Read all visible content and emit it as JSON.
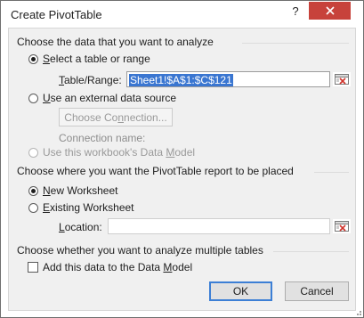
{
  "window": {
    "title": "Create PivotTable"
  },
  "title_buttons": {
    "help_label": "?",
    "close_icon": "close-icon"
  },
  "data_source": {
    "heading": "Choose the data that you want to analyze",
    "select_table": {
      "pre": "",
      "u": "S",
      "post": "elect a table or range",
      "checked": true
    },
    "table_range": {
      "u": "T",
      "post": "able/Range:",
      "value": "Sheet1!$A$1:$C$121"
    },
    "external": {
      "u": "U",
      "post": "se an external data source",
      "checked": false
    },
    "choose_connection": {
      "pre": "Choose Co",
      "u": "n",
      "post": "nection..."
    },
    "connection_name_label": "Connection name:",
    "data_model": {
      "pre": "Use this workbook's Data ",
      "u": "M",
      "post": "odel",
      "checked": false,
      "disabled": true
    }
  },
  "placement": {
    "heading": "Choose where you want the PivotTable report to be placed",
    "new_worksheet": {
      "u": "N",
      "post": "ew Worksheet",
      "checked": true
    },
    "existing_worksheet": {
      "u": "E",
      "post": "xisting Worksheet",
      "checked": false
    },
    "location": {
      "u": "L",
      "post": "ocation:",
      "value": ""
    }
  },
  "multiple_tables": {
    "heading": "Choose whether you want to analyze multiple tables",
    "add_to_model": {
      "pre": "Add this data to the Data ",
      "u": "M",
      "post": "odel",
      "checked": false
    }
  },
  "buttons": {
    "ok": "OK",
    "cancel": "Cancel"
  },
  "colors": {
    "close_bg": "#c7423b",
    "selection": "#3a76d1",
    "default_border": "#3c7fd5"
  }
}
